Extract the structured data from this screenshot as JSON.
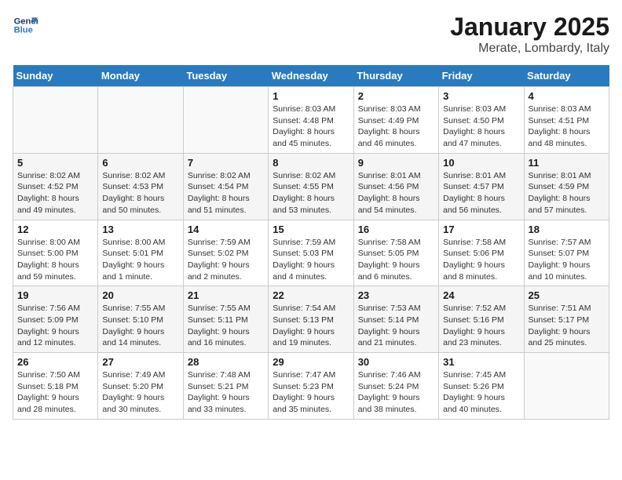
{
  "logo": {
    "line1": "General",
    "line2": "Blue"
  },
  "title": "January 2025",
  "subtitle": "Merate, Lombardy, Italy",
  "weekdays": [
    "Sunday",
    "Monday",
    "Tuesday",
    "Wednesday",
    "Thursday",
    "Friday",
    "Saturday"
  ],
  "weeks": [
    [
      {
        "day": "",
        "info": ""
      },
      {
        "day": "",
        "info": ""
      },
      {
        "day": "",
        "info": ""
      },
      {
        "day": "1",
        "info": "Sunrise: 8:03 AM\nSunset: 4:48 PM\nDaylight: 8 hours\nand 45 minutes."
      },
      {
        "day": "2",
        "info": "Sunrise: 8:03 AM\nSunset: 4:49 PM\nDaylight: 8 hours\nand 46 minutes."
      },
      {
        "day": "3",
        "info": "Sunrise: 8:03 AM\nSunset: 4:50 PM\nDaylight: 8 hours\nand 47 minutes."
      },
      {
        "day": "4",
        "info": "Sunrise: 8:03 AM\nSunset: 4:51 PM\nDaylight: 8 hours\nand 48 minutes."
      }
    ],
    [
      {
        "day": "5",
        "info": "Sunrise: 8:02 AM\nSunset: 4:52 PM\nDaylight: 8 hours\nand 49 minutes."
      },
      {
        "day": "6",
        "info": "Sunrise: 8:02 AM\nSunset: 4:53 PM\nDaylight: 8 hours\nand 50 minutes."
      },
      {
        "day": "7",
        "info": "Sunrise: 8:02 AM\nSunset: 4:54 PM\nDaylight: 8 hours\nand 51 minutes."
      },
      {
        "day": "8",
        "info": "Sunrise: 8:02 AM\nSunset: 4:55 PM\nDaylight: 8 hours\nand 53 minutes."
      },
      {
        "day": "9",
        "info": "Sunrise: 8:01 AM\nSunset: 4:56 PM\nDaylight: 8 hours\nand 54 minutes."
      },
      {
        "day": "10",
        "info": "Sunrise: 8:01 AM\nSunset: 4:57 PM\nDaylight: 8 hours\nand 56 minutes."
      },
      {
        "day": "11",
        "info": "Sunrise: 8:01 AM\nSunset: 4:59 PM\nDaylight: 8 hours\nand 57 minutes."
      }
    ],
    [
      {
        "day": "12",
        "info": "Sunrise: 8:00 AM\nSunset: 5:00 PM\nDaylight: 8 hours\nand 59 minutes."
      },
      {
        "day": "13",
        "info": "Sunrise: 8:00 AM\nSunset: 5:01 PM\nDaylight: 9 hours\nand 1 minute."
      },
      {
        "day": "14",
        "info": "Sunrise: 7:59 AM\nSunset: 5:02 PM\nDaylight: 9 hours\nand 2 minutes."
      },
      {
        "day": "15",
        "info": "Sunrise: 7:59 AM\nSunset: 5:03 PM\nDaylight: 9 hours\nand 4 minutes."
      },
      {
        "day": "16",
        "info": "Sunrise: 7:58 AM\nSunset: 5:05 PM\nDaylight: 9 hours\nand 6 minutes."
      },
      {
        "day": "17",
        "info": "Sunrise: 7:58 AM\nSunset: 5:06 PM\nDaylight: 9 hours\nand 8 minutes."
      },
      {
        "day": "18",
        "info": "Sunrise: 7:57 AM\nSunset: 5:07 PM\nDaylight: 9 hours\nand 10 minutes."
      }
    ],
    [
      {
        "day": "19",
        "info": "Sunrise: 7:56 AM\nSunset: 5:09 PM\nDaylight: 9 hours\nand 12 minutes."
      },
      {
        "day": "20",
        "info": "Sunrise: 7:55 AM\nSunset: 5:10 PM\nDaylight: 9 hours\nand 14 minutes."
      },
      {
        "day": "21",
        "info": "Sunrise: 7:55 AM\nSunset: 5:11 PM\nDaylight: 9 hours\nand 16 minutes."
      },
      {
        "day": "22",
        "info": "Sunrise: 7:54 AM\nSunset: 5:13 PM\nDaylight: 9 hours\nand 19 minutes."
      },
      {
        "day": "23",
        "info": "Sunrise: 7:53 AM\nSunset: 5:14 PM\nDaylight: 9 hours\nand 21 minutes."
      },
      {
        "day": "24",
        "info": "Sunrise: 7:52 AM\nSunset: 5:16 PM\nDaylight: 9 hours\nand 23 minutes."
      },
      {
        "day": "25",
        "info": "Sunrise: 7:51 AM\nSunset: 5:17 PM\nDaylight: 9 hours\nand 25 minutes."
      }
    ],
    [
      {
        "day": "26",
        "info": "Sunrise: 7:50 AM\nSunset: 5:18 PM\nDaylight: 9 hours\nand 28 minutes."
      },
      {
        "day": "27",
        "info": "Sunrise: 7:49 AM\nSunset: 5:20 PM\nDaylight: 9 hours\nand 30 minutes."
      },
      {
        "day": "28",
        "info": "Sunrise: 7:48 AM\nSunset: 5:21 PM\nDaylight: 9 hours\nand 33 minutes."
      },
      {
        "day": "29",
        "info": "Sunrise: 7:47 AM\nSunset: 5:23 PM\nDaylight: 9 hours\nand 35 minutes."
      },
      {
        "day": "30",
        "info": "Sunrise: 7:46 AM\nSunset: 5:24 PM\nDaylight: 9 hours\nand 38 minutes."
      },
      {
        "day": "31",
        "info": "Sunrise: 7:45 AM\nSunset: 5:26 PM\nDaylight: 9 hours\nand 40 minutes."
      },
      {
        "day": "",
        "info": ""
      }
    ]
  ]
}
